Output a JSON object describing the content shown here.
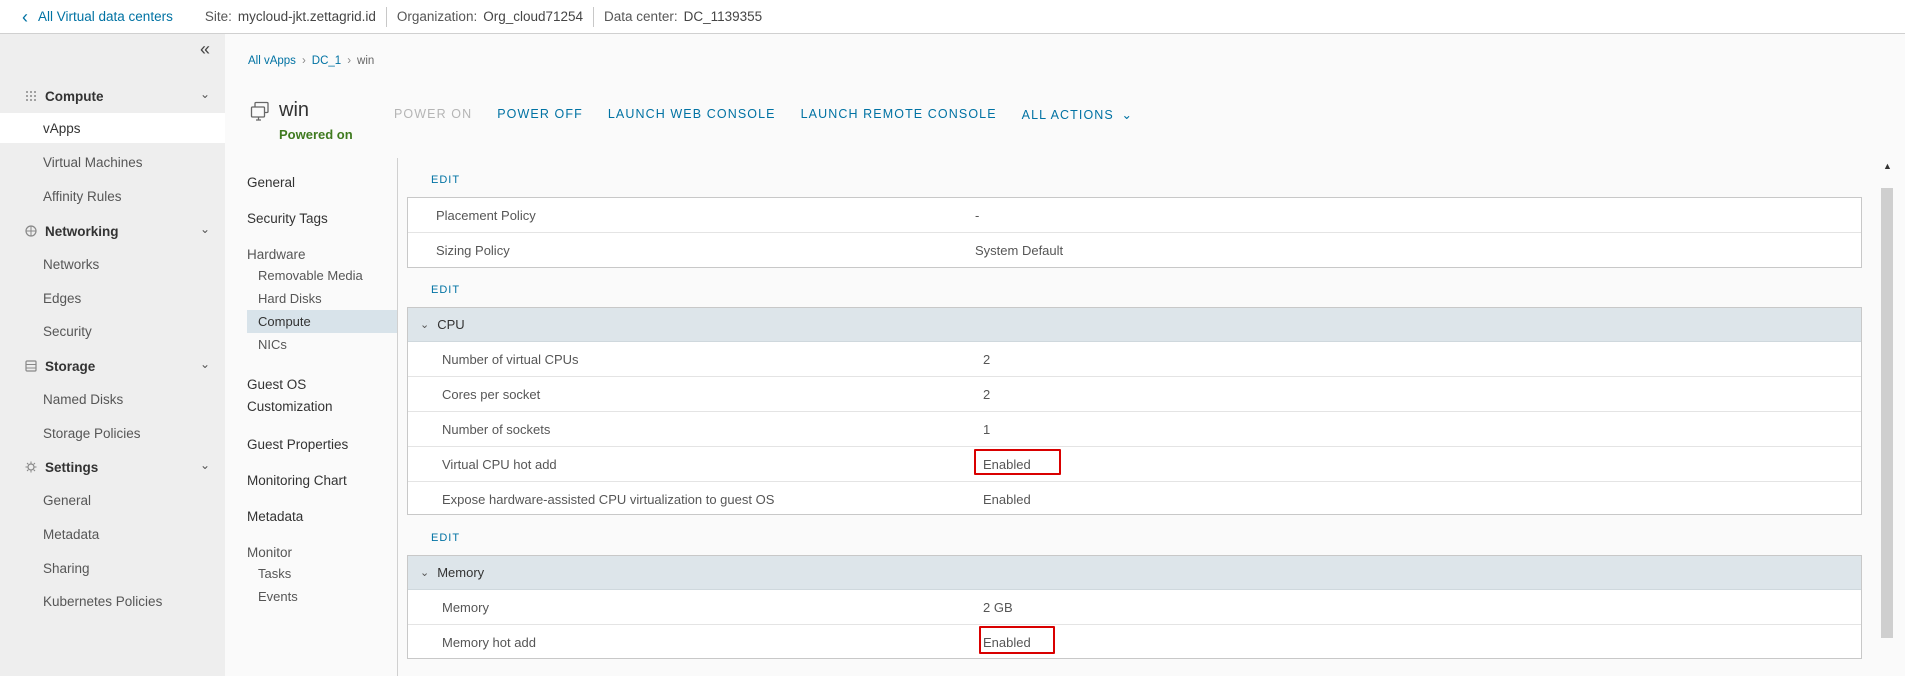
{
  "header": {
    "back_label": "All Virtual data centers",
    "site_label": "Site:",
    "site_value": "mycloud-jkt.zettagrid.id",
    "org_label": "Organization:",
    "org_value": "Org_cloud71254",
    "dc_label": "Data center:",
    "dc_value": "DC_1139355"
  },
  "sidebar": {
    "sections": [
      {
        "label": "Compute",
        "icon": "grid-icon",
        "items": [
          "vApps",
          "Virtual Machines",
          "Affinity Rules"
        ]
      },
      {
        "label": "Networking",
        "icon": "network-icon",
        "items": [
          "Networks",
          "Edges",
          "Security"
        ]
      },
      {
        "label": "Storage",
        "icon": "storage-icon",
        "items": [
          "Named Disks",
          "Storage Policies"
        ]
      },
      {
        "label": "Settings",
        "icon": "gear-icon",
        "items": [
          "General",
          "Metadata",
          "Sharing",
          "Kubernetes Policies"
        ]
      }
    ],
    "active_item": "vApps"
  },
  "breadcrumb": {
    "items": [
      "All vApps",
      "DC_1",
      "win"
    ]
  },
  "vm": {
    "name": "win",
    "status": "Powered on"
  },
  "actions": {
    "power_on": "POWER ON",
    "power_off": "POWER OFF",
    "launch_web_console": "LAUNCH WEB CONSOLE",
    "launch_remote_console": "LAUNCH REMOTE CONSOLE",
    "all_actions": "ALL ACTIONS"
  },
  "subnav": {
    "general": "General",
    "security_tags": "Security Tags",
    "hardware": "Hardware",
    "hardware_items": [
      "Removable Media",
      "Hard Disks",
      "Compute",
      "NICs"
    ],
    "guest_os_1": "Guest OS",
    "guest_os_2": "Customization",
    "guest_properties": "Guest Properties",
    "monitoring_chart": "Monitoring Chart",
    "metadata": "Metadata",
    "monitor": "Monitor",
    "monitor_items": [
      "Tasks",
      "Events"
    ]
  },
  "content": {
    "edit_label": "EDIT",
    "policy": {
      "rows": [
        {
          "key": "Placement Policy",
          "value": "-"
        },
        {
          "key": "Sizing Policy",
          "value": "System Default"
        }
      ]
    },
    "cpu": {
      "title": "CPU",
      "rows": [
        {
          "key": "Number of virtual CPUs",
          "value": "2"
        },
        {
          "key": "Cores per socket",
          "value": "2"
        },
        {
          "key": "Number of sockets",
          "value": "1"
        },
        {
          "key": "Virtual CPU hot add",
          "value": "Enabled"
        },
        {
          "key": "Expose hardware-assisted CPU virtualization to guest OS",
          "value": "Enabled"
        }
      ]
    },
    "memory": {
      "title": "Memory",
      "rows": [
        {
          "key": "Memory",
          "value": "2 GB"
        },
        {
          "key": "Memory hot add",
          "value": "Enabled"
        }
      ]
    }
  },
  "colors": {
    "link": "#0072a3",
    "status_on": "#3f7a1f",
    "highlight": "#d90000",
    "sidebar_bg": "#eeeeee",
    "card_header": "#dde5ea"
  }
}
